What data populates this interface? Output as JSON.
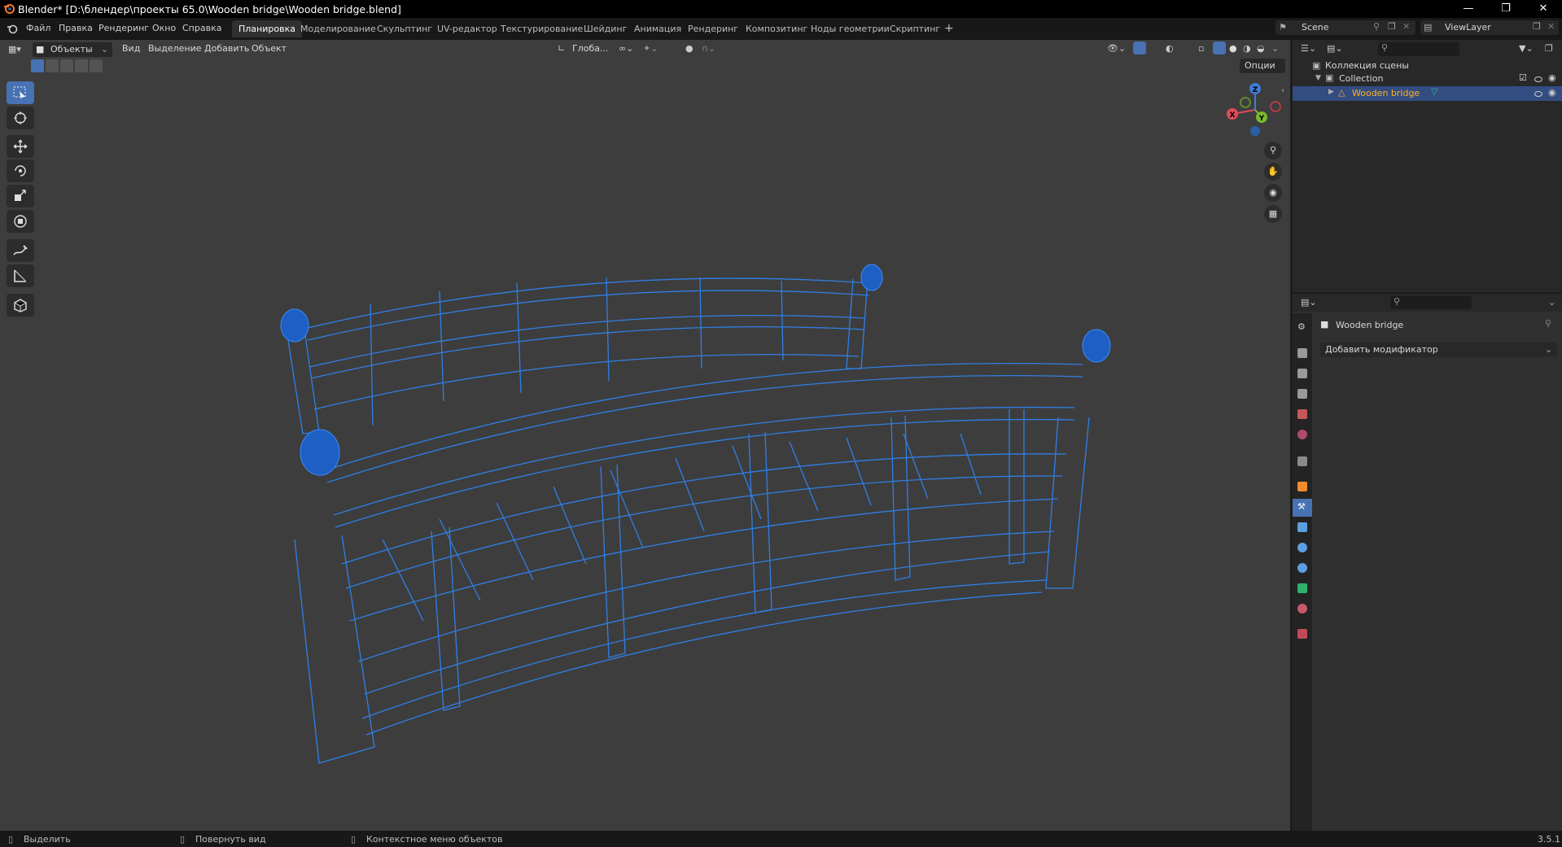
{
  "window": {
    "title": "Blender* [D:\\блендер\\проекты 65.0\\Wooden bridge\\Wooden bridge.blend]"
  },
  "menu": [
    "Файл",
    "Правка",
    "Рендеринг",
    "Окно",
    "Справка"
  ],
  "workspaces": [
    "Планировка",
    "Моделирование",
    "Скульптинг",
    "UV-редактор",
    "Текстурирование",
    "Шейдинг",
    "Анимация",
    "Рендеринг",
    "Композитинг",
    "Ноды геометрии",
    "Скриптинг"
  ],
  "workspace_add": "+",
  "scene": {
    "name": "Scene",
    "view_layer": "ViewLayer"
  },
  "viewport_header": {
    "mode": "Объекты",
    "menus": [
      "Вид",
      "Выделение",
      "Добавить",
      "Объект"
    ],
    "orientation": "Глоба...",
    "options": "Опции"
  },
  "gizmo": {
    "x": "X",
    "y": "Y",
    "z": "Z"
  },
  "outliner": {
    "root": "Коллекция сцены",
    "collection": "Collection",
    "object": "Wooden bridge"
  },
  "properties": {
    "object_name": "Wooden bridge",
    "add_modifier": "Добавить модификатор"
  },
  "statusbar": {
    "select": "Выделить",
    "rotate": "Повернуть вид",
    "context": "Контекстное меню объектов",
    "version": "3.5.1"
  },
  "colors": {
    "accent": "#4772b3",
    "wire": "#2f7fe6",
    "viewport_bg": "#3d3d3d"
  }
}
